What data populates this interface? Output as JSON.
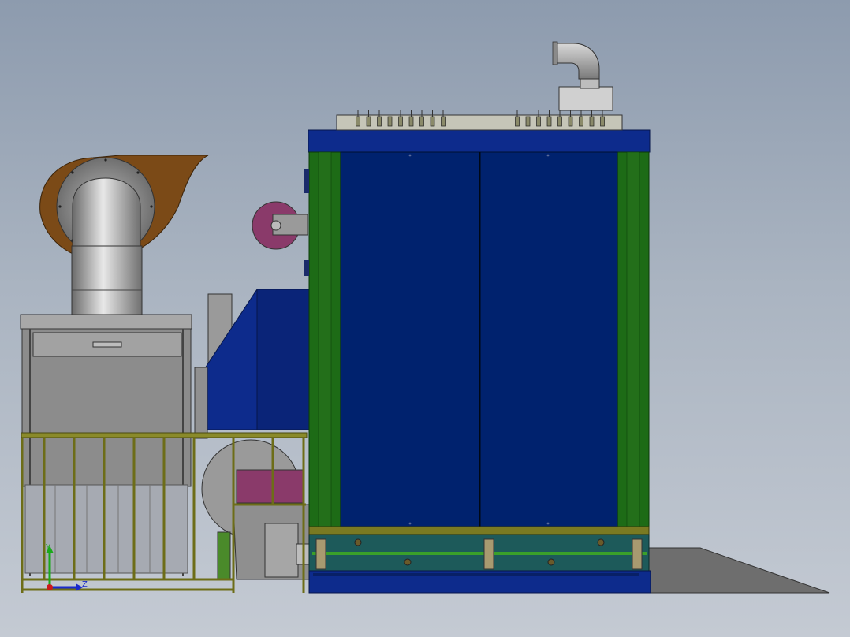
{
  "axes": {
    "y_label": "Y",
    "z_label": "Z"
  },
  "colors": {
    "background_top": "#8d9bae",
    "background_bottom": "#c4cad3",
    "cabinet_blue": "#0a2a7a",
    "frame_blue": "#0d2b8c",
    "frame_green": "#1d6b16",
    "olive_rail": "#7a7a22",
    "steel": "#8f8f8f",
    "fan_housing_brown": "#7a4a1a",
    "motor_purple": "#8a3a6a",
    "axis_y": "#1aaa1a",
    "axis_z": "#1a2acc",
    "axis_origin": "#cc1a1a"
  }
}
